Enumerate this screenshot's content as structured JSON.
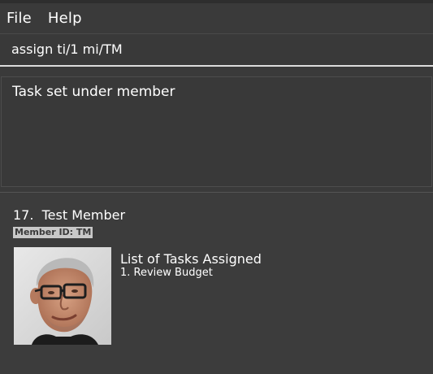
{
  "menu": {
    "file_label": "File",
    "help_label": "Help"
  },
  "command": {
    "value": "assign ti/1 mi/TM"
  },
  "result": {
    "message": "Task set under member"
  },
  "member": {
    "index_name": "17.  Test Member",
    "id_badge": "Member ID: TM",
    "photo_icon": "member-photo",
    "tasks_heading": "List of Tasks Assigned",
    "tasks": [
      "1. Review Budget"
    ]
  },
  "colors": {
    "background": "#3a3a3a",
    "badge_bg": "#c8c8c8",
    "text": "#ffffff"
  }
}
